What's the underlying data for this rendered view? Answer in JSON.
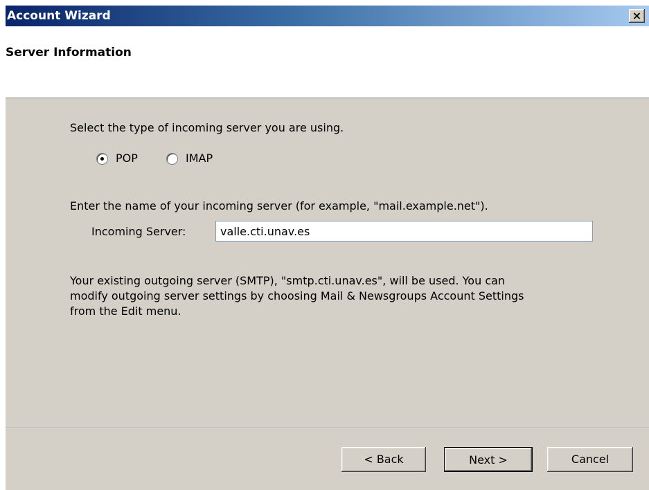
{
  "window": {
    "title": "Account Wizard",
    "close_label": "×"
  },
  "header": {
    "title": "Server Information"
  },
  "server_type": {
    "prompt": "Select the type of incoming server you are using.",
    "options": [
      {
        "label": "POP",
        "selected": true
      },
      {
        "label": "IMAP",
        "selected": false
      }
    ]
  },
  "incoming": {
    "prompt": "Enter the name of your incoming server (for example, \"mail.example.net\").",
    "label": "Incoming Server:",
    "value": "valle.cti.unav.es"
  },
  "info": {
    "line1": "Your existing outgoing server (SMTP), \"smtp.cti.unav.es\", will be used. You can",
    "line2": "modify outgoing server settings by choosing Mail & Newsgroups Account Settings",
    "line3": "from the Edit menu."
  },
  "buttons": {
    "back": "< Back",
    "next": "Next >",
    "cancel": "Cancel"
  }
}
